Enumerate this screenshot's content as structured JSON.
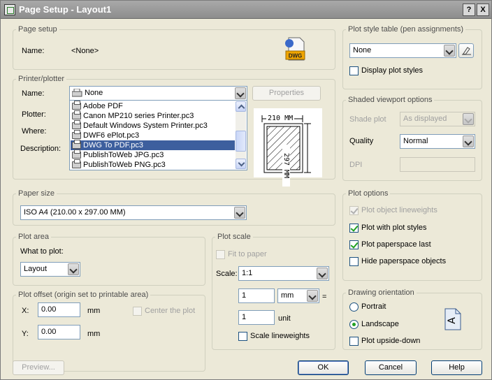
{
  "window": {
    "title": "Page Setup - Layout1",
    "help_btn": "?",
    "close_btn": "X"
  },
  "page_setup": {
    "legend": "Page setup",
    "name_label": "Name:",
    "name_value": "<None>",
    "dwg_badge": "DWG"
  },
  "printer": {
    "legend": "Printer/plotter",
    "name_label": "Name:",
    "selected": "None",
    "properties_button": "Properties",
    "plotter_label": "Plotter:",
    "where_label": "Where:",
    "description_label": "Description:",
    "options": [
      "Adobe PDF",
      "Canon MP210 series Printer.pc3",
      "Default Windows System Printer.pc3",
      "DWF6 ePlot.pc3",
      "DWG To PDF.pc3",
      "PublishToWeb JPG.pc3",
      "PublishToWeb PNG.pc3"
    ],
    "selected_index": 4,
    "paper_width_label": "210 MM",
    "paper_height_label": "297 MM"
  },
  "paper_size": {
    "legend": "Paper size",
    "value": "ISO A4 (210.00 x 297.00 MM)"
  },
  "plot_area": {
    "legend": "Plot area",
    "what_label": "What to plot:",
    "value": "Layout"
  },
  "plot_offset": {
    "legend": "Plot offset (origin set to printable area)",
    "x_label": "X:",
    "x_value": "0.00",
    "x_unit": "mm",
    "y_label": "Y:",
    "y_value": "0.00",
    "y_unit": "mm",
    "center_label": "Center the plot",
    "center_checked": false
  },
  "plot_scale": {
    "legend": "Plot scale",
    "fit_label": "Fit to paper",
    "fit_checked": false,
    "scale_label": "Scale:",
    "scale_value": "1:1",
    "value1": "1",
    "unit1": "mm",
    "equals": "=",
    "value2": "1",
    "unit2": "unit",
    "lineweights_label": "Scale lineweights",
    "lineweights_checked": false
  },
  "plot_style_table": {
    "legend": "Plot style table (pen assignments)",
    "value": "None",
    "display_label": "Display plot styles",
    "display_checked": false
  },
  "shaded_viewport": {
    "legend": "Shaded viewport options",
    "shade_label": "Shade plot",
    "shade_value": "As displayed",
    "quality_label": "Quality",
    "quality_value": "Normal",
    "dpi_label": "DPI",
    "dpi_value": ""
  },
  "plot_options": {
    "legend": "Plot options",
    "items": [
      {
        "label": "Plot object lineweights",
        "checked": true,
        "disabled": true
      },
      {
        "label": "Plot with plot styles",
        "checked": true,
        "disabled": false
      },
      {
        "label": "Plot paperspace last",
        "checked": true,
        "disabled": false
      },
      {
        "label": "Hide paperspace objects",
        "checked": false,
        "disabled": false
      }
    ]
  },
  "orientation": {
    "legend": "Drawing orientation",
    "portrait_label": "Portrait",
    "landscape_label": "Landscape",
    "selected": "Landscape",
    "upside_label": "Plot upside-down",
    "upside_checked": false,
    "orientation_glyph": "A"
  },
  "footer": {
    "preview_button": "Preview...",
    "ok_button": "OK",
    "cancel_button": "Cancel",
    "help_button": "Help"
  }
}
